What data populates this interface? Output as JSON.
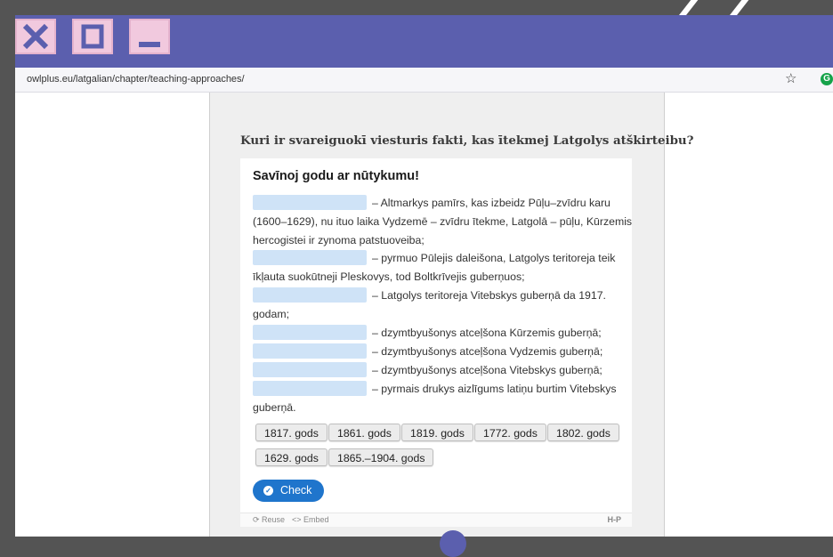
{
  "window": {
    "close_icon": "close-x-icon",
    "maximize_icon": "maximize-square-icon",
    "minimize_icon": "minimize-bar-icon"
  },
  "address_bar": {
    "url": "owlplus.eu/latgalian/chapter/teaching-approaches/",
    "bookmark_icon": "star-icon",
    "extension_icon": "grammarly-icon"
  },
  "activity": {
    "question": "Kuri ir svareiguokī viesturis fakti, kas ītekmej Latgolys atškirteibu?",
    "title": "Savīnoj godu ar nūtykumu!",
    "lines": [
      "– Altmarkys pamīrs, kas izbeidz Pūļu–zvīdru karu",
      "(1600–1629), nu ituo laika Vydzemē – zvīdru ītekme, Latgolā – pūļu, Kūrzemis",
      "hercogistei ir zynoma patstuoveiba;",
      "– pyrmuo Pūlejis daleišona, Latgolys teritoreja teik",
      "īkļauta suokūtneji Pleskovys, tod Boltkrīvejis guberņuos;",
      "– Latgolys teritoreja Vitebskys guberņā da 1917.",
      "godam;",
      "– dzymtbyušonys atceļšona Kūrzemis guberņā;",
      "– dzymtbyušonys atceļšona Vydzemis guberņā;",
      "– dzymtbyušonys atceļšona Vitebskys guberņā;",
      "– pyrmais drukys aizlīgums latiņu burtim Vitebskys",
      "guberņā."
    ],
    "options": [
      "1817. gods",
      "1861. gods",
      "1819. gods",
      "1772. gods",
      "1802. gods",
      "1629. gods",
      "1865.–1904. gods"
    ],
    "check_label": "Check",
    "footer": {
      "reuse": "Reuse",
      "embed": "Embed",
      "brand": "H-P"
    }
  },
  "colors": {
    "window_bg": "#5b5fae",
    "desktop_bg": "#545454",
    "window_button": "#f1c9de",
    "drop_zone": "#cfe3f7",
    "check_button": "#1f75cc"
  }
}
